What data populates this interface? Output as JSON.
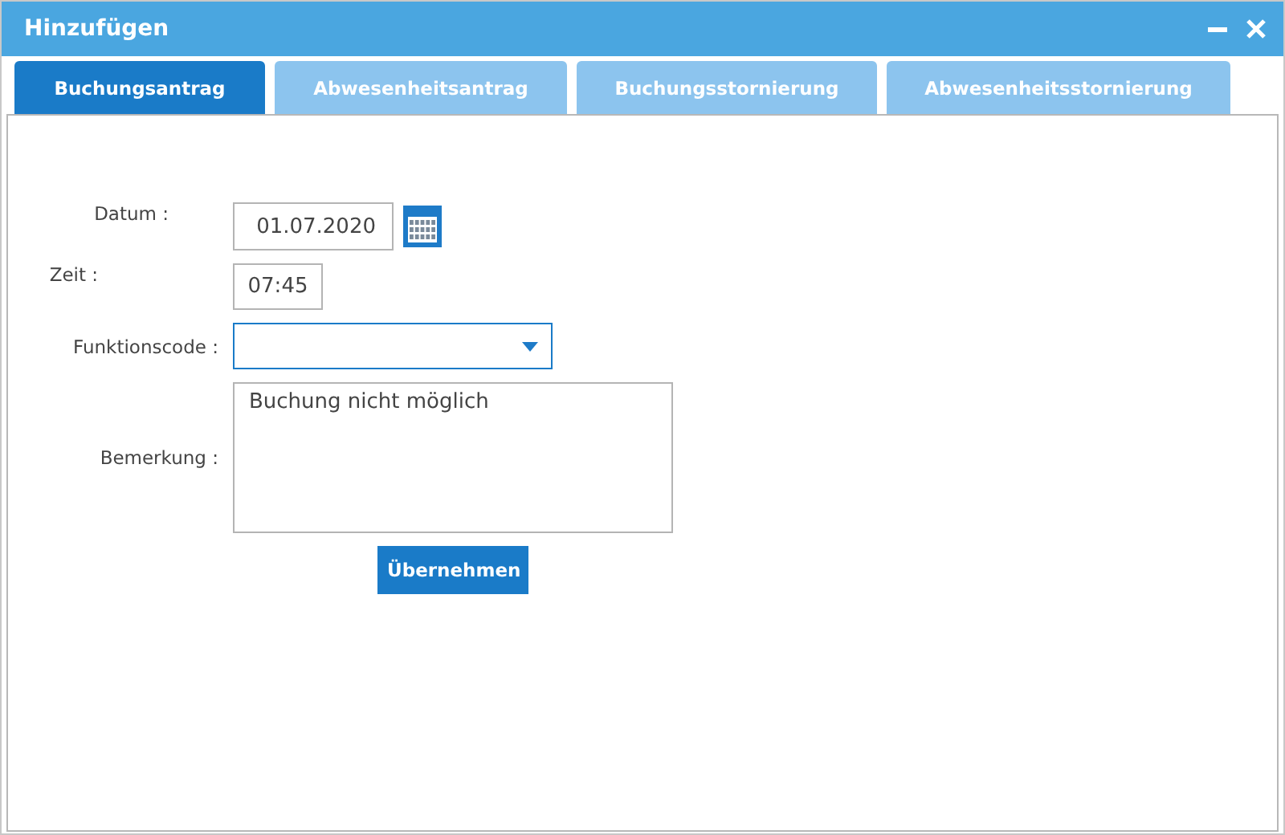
{
  "window": {
    "title": "Hinzufügen"
  },
  "tabs": [
    {
      "label": "Buchungsantrag",
      "selected": true
    },
    {
      "label": "Abwesenheitsantrag",
      "selected": false
    },
    {
      "label": "Buchungsstornierung",
      "selected": false
    },
    {
      "label": "Abwesenheitsstornierung",
      "selected": false
    }
  ],
  "form": {
    "fields": [
      {
        "kind": "date",
        "label": "Datum :",
        "value": "01.07.2020"
      },
      {
        "kind": "time",
        "label": "Zeit :",
        "value": "07:45"
      },
      {
        "kind": "select",
        "label": "Funktionscode :"
      },
      {
        "kind": "textarea",
        "label": "Bemerkung :",
        "value": "Buchung nicht möglich"
      }
    ],
    "submit": "Übernehmen"
  }
}
